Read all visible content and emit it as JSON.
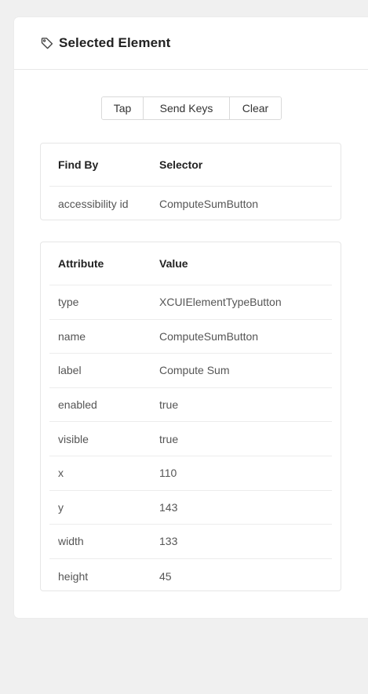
{
  "panel": {
    "title": "Selected Element",
    "icon": "tag-icon"
  },
  "actions": {
    "tap": "Tap",
    "send_keys": "Send Keys",
    "clear": "Clear"
  },
  "find_by": {
    "headers": [
      "Find By",
      "Selector"
    ],
    "rows": [
      [
        "accessibility id",
        "ComputeSumButton"
      ]
    ]
  },
  "attributes": {
    "headers": [
      "Attribute",
      "Value"
    ],
    "rows": [
      [
        "type",
        "XCUIElementTypeButton"
      ],
      [
        "name",
        "ComputeSumButton"
      ],
      [
        "label",
        "Compute Sum"
      ],
      [
        "enabled",
        "true"
      ],
      [
        "visible",
        "true"
      ],
      [
        "x",
        "110"
      ],
      [
        "y",
        "143"
      ],
      [
        "width",
        "133"
      ],
      [
        "height",
        "45"
      ]
    ]
  }
}
